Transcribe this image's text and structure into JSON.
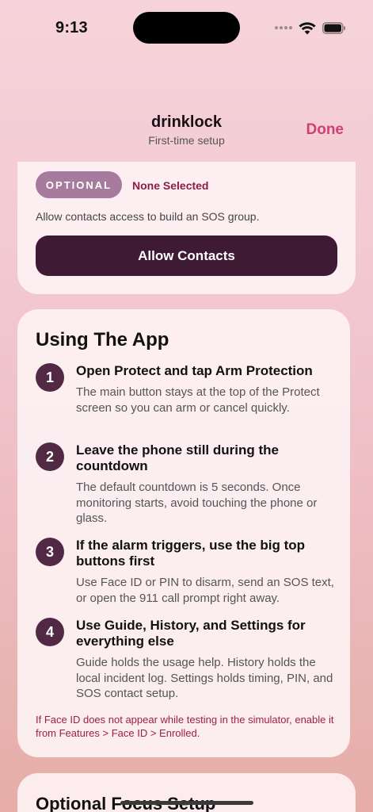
{
  "status_bar": {
    "time": "9:13",
    "icons": [
      "cellular-dots-icon",
      "wifi-icon",
      "battery-icon"
    ]
  },
  "nav": {
    "title": "drinklock",
    "subtitle": "First-time setup",
    "done_label": "Done"
  },
  "contacts_card": {
    "badge": "OPTIONAL",
    "selection_status": "None Selected",
    "description": "Allow contacts access to build an SOS group.",
    "button_label": "Allow Contacts"
  },
  "usage_card": {
    "title": "Using The App",
    "steps": [
      {
        "number": "1",
        "title": "Open Protect and tap Arm Protection",
        "description": "The main button stays at the top of the Protect screen so you can arm or cancel quickly."
      },
      {
        "number": "2",
        "title": "Leave the phone still during the countdown",
        "description": "The default countdown is 5 seconds. Once monitoring starts, avoid touching the phone or glass."
      },
      {
        "number": "3",
        "title": "If the alarm triggers, use the big top buttons first",
        "description": "Use Face ID or PIN to disarm, send an SOS text, or open the 911 call prompt right away."
      },
      {
        "number": "4",
        "title": "Use Guide, History, and Settings for everything else",
        "description": "Guide holds the usage help. History holds the local incident log. Settings holds timing, PIN, and SOS contact setup."
      }
    ],
    "note": "If Face ID does not appear while testing in the simulator, enable it from Features > Face ID > Enrolled."
  },
  "focus_card": {
    "title": "Optional Focus Setup"
  },
  "colors": {
    "accent": "#cf3f72",
    "primary_button": "#3f1a35",
    "badge": "#a77b9d",
    "step_circle": "#512945",
    "warning_text": "#9e2043"
  }
}
